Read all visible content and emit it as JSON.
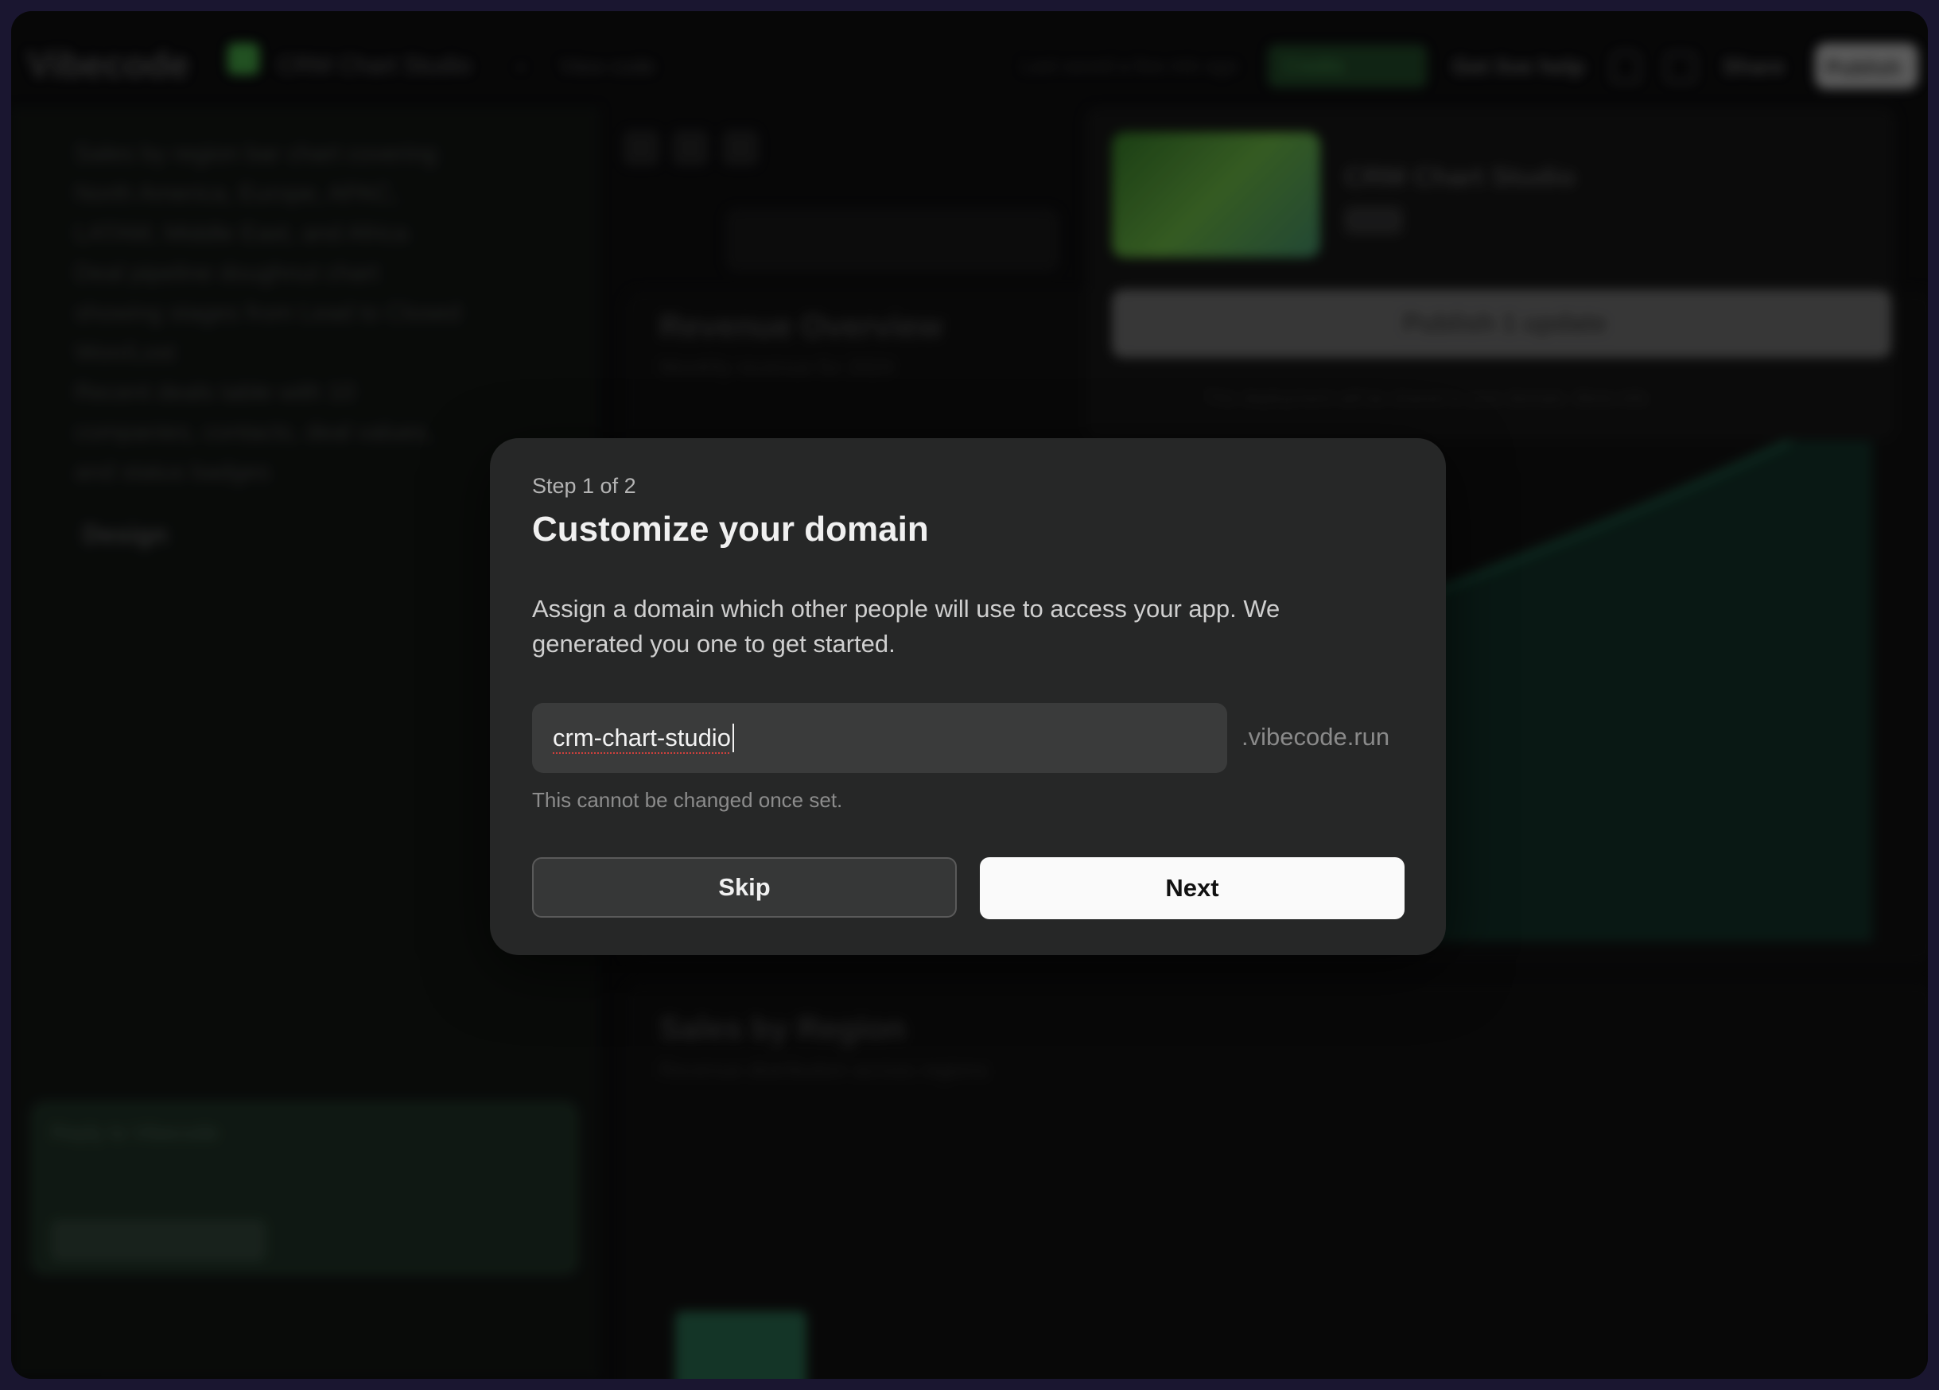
{
  "app": {
    "logo": "Vibecode",
    "project_name": "CRM Chart Studio",
    "view_code": "View code",
    "last_saved": "Last saved a few min ago",
    "credits": "Credits",
    "get_help": "Get live help",
    "share": "Share",
    "publish": "Publish"
  },
  "sidebar": {
    "lines": [
      "Sales by region bar chart covering",
      "North America, Europe, APAC,",
      "LATAM, Middle East, and Africa",
      "Deal pipeline doughnut chart",
      "showing stages from Lead to Closed",
      "Won/Lost",
      "Recent deals table with 10",
      "companies, contacts, deal values,",
      "and status badges"
    ],
    "design_heading": "Design",
    "chat_placeholder": "Reply to Vibecode",
    "model": "Claude Opus 4.5"
  },
  "main": {
    "revenue_title": "Revenue Overview",
    "revenue_sub": "Monthly revenue for 2024",
    "sales_title": "Sales by Region",
    "sales_sub": "Revenue distribution across regions",
    "bar_colors": [
      "#235a42",
      "#3e2680",
      "#6b5a22"
    ],
    "bar_levels": [
      0.72,
      0.33,
      0.21
    ]
  },
  "publish_panel": {
    "name": "CRM Chart Studio",
    "button": "Publish 1 update",
    "note": "This deployment will be shared to your domain.  More info"
  },
  "modal": {
    "step": "Step 1 of 2",
    "title": "Customize your domain",
    "description": "Assign a domain which other people will use to access your app. We generated you one to get started.",
    "domain_value": "crm-chart-studio",
    "domain_suffix": ".vibecode.run",
    "hint": "This cannot be changed once set.",
    "skip_label": "Skip",
    "next_label": "Next"
  }
}
